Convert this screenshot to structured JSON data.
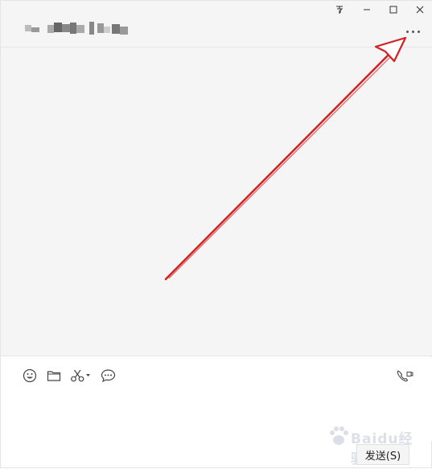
{
  "window": {
    "controls": [
      "pin-icon",
      "minimize-icon",
      "maximize-icon",
      "close-icon"
    ]
  },
  "header": {
    "chat_title": "",
    "more_icon": "more-dots-icon"
  },
  "toolbar": {
    "left_tools": [
      "emoji-icon",
      "folder-icon",
      "scissors-icon",
      "chat-bubble-icon"
    ],
    "right_tools": [
      "video-call-icon"
    ]
  },
  "input": {
    "value": ""
  },
  "send_label": "发送(S)",
  "watermark": {
    "text": "Baidu经验"
  },
  "colors": {
    "annotation_arrow": "#d42020",
    "panel_bg": "#f5f5f5"
  }
}
